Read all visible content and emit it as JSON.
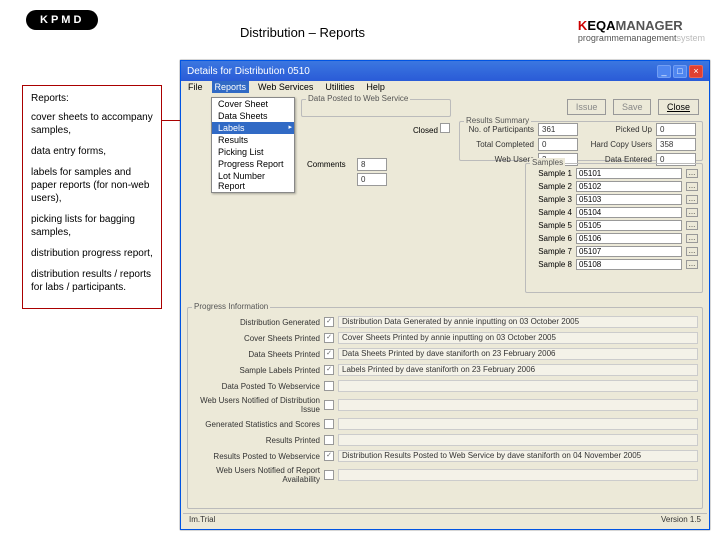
{
  "header": {
    "logo": "KPMD",
    "title": "Distribution – Reports",
    "brand_k": "K",
    "brand_eqa": "EQA",
    "brand_mgr": "MANAGER",
    "brand_pm": "programmemanagement",
    "brand_sys": "system"
  },
  "sidebar": {
    "heading": "Reports:",
    "items": [
      "cover sheets to accompany samples,",
      "data entry forms,",
      "labels for samples and paper reports (for non-web users),",
      "picking lists for bagging samples,",
      "distribution progress report,",
      "distribution results / reports for labs / participants."
    ]
  },
  "window": {
    "title": "Details for Distribution 0510",
    "menus": [
      "File",
      "Reports",
      "Web Services",
      "Utilities",
      "Help"
    ],
    "dropdown": [
      "Cover Sheet",
      "Data Sheets",
      "Labels",
      "Results",
      "Picking List",
      "Progress Report",
      "Lot Number Report"
    ],
    "btn_issue": "Issue",
    "btn_save": "Save",
    "btn_close": "Close",
    "dataposted_label": "Data Posted to Web Service",
    "closed_label": "Closed",
    "comments_label": "Comments",
    "comments_val": "8",
    "comments_val2": "0",
    "results_summary": {
      "label": "Results Summary",
      "participants_l": "No. of Participants",
      "participants_v": "361",
      "picked_l": "Picked Up",
      "picked_v": "0",
      "totalcomp_l": "Total Completed",
      "totalcomp_v": "0",
      "hardcopy_l": "Hard Copy Users",
      "hardcopy_v": "358",
      "webusers_l": "Web Users",
      "webusers_v": "3",
      "dataent_l": "Data Entered",
      "dataent_v": "0"
    },
    "samples": {
      "label": "Samples",
      "rows": [
        {
          "l": "Sample 1",
          "v": "05101"
        },
        {
          "l": "Sample 2",
          "v": "05102"
        },
        {
          "l": "Sample 3",
          "v": "05103"
        },
        {
          "l": "Sample 4",
          "v": "05104"
        },
        {
          "l": "Sample 5",
          "v": "05105"
        },
        {
          "l": "Sample 6",
          "v": "05106"
        },
        {
          "l": "Sample 7",
          "v": "05107"
        },
        {
          "l": "Sample 8",
          "v": "05108"
        }
      ]
    },
    "progress": {
      "label": "Progress Information",
      "rows": [
        {
          "l": "Distribution Generated",
          "ck": true,
          "t": "Distribution Data Generated by annie inputting on 03 October 2005"
        },
        {
          "l": "Cover Sheets Printed",
          "ck": true,
          "t": "Cover Sheets Printed by annie inputting on 03 October 2005"
        },
        {
          "l": "Data Sheets Printed",
          "ck": true,
          "t": "Data Sheets Printed by dave staniforth on 23 February 2006"
        },
        {
          "l": "Sample Labels Printed",
          "ck": true,
          "t": "Labels Printed by dave staniforth on 23 February 2006"
        },
        {
          "l": "Data Posted To Webservice",
          "ck": false,
          "t": ""
        },
        {
          "l": "Web Users Notified of Distribution Issue",
          "ck": false,
          "t": ""
        },
        {
          "l": "Generated Statistics and Scores",
          "ck": false,
          "t": ""
        },
        {
          "l": "Results Printed",
          "ck": false,
          "t": ""
        },
        {
          "l": "Results Posted to Webservice",
          "ck": true,
          "t": "Distribution Results Posted to Web Service by dave staniforth on 04 November 2005"
        },
        {
          "l": "Web Users Notified of Report Availability",
          "ck": false,
          "t": ""
        }
      ]
    },
    "status_left": "Im.Trial",
    "status_right": "Version 1.5"
  }
}
